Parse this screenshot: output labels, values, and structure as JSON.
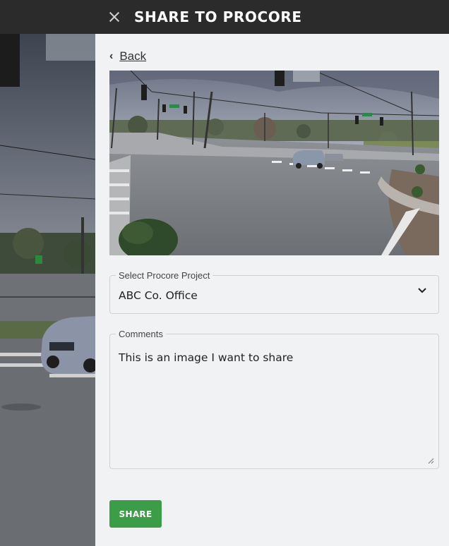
{
  "header": {
    "title": "SHARE TO PROCORE",
    "close_icon": "close-icon"
  },
  "nav": {
    "back_label": "Back",
    "back_icon": "chevron-left-icon"
  },
  "project_select": {
    "label": "Select Procore Project",
    "value": "ABC Co. Office",
    "icon": "chevron-down-icon"
  },
  "comments": {
    "label": "Comments",
    "value": "This is an image I want to share"
  },
  "actions": {
    "share_label": "SHARE"
  },
  "colors": {
    "header_bg": "#2b2b2b",
    "panel_bg": "#f1f2f3",
    "share_button": "#3b9e47"
  }
}
